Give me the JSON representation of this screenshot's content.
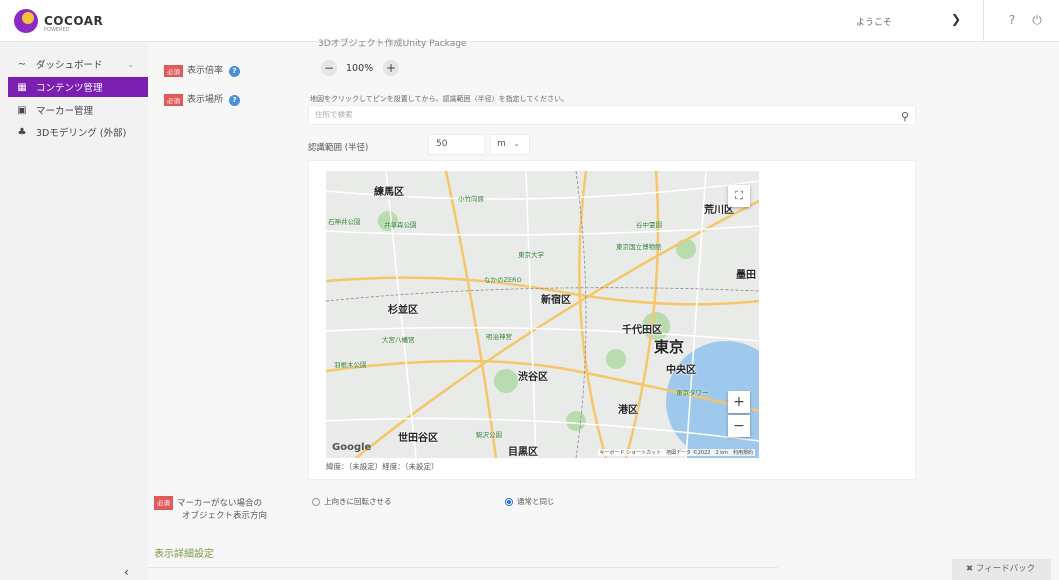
{
  "header": {
    "logo_text": "COCOAR",
    "logo_sub": "POWERED",
    "welcome": "ようこそ",
    "chevron_icon": "chevron-down-icon",
    "help_icon": "help-icon",
    "power_icon": "power-icon"
  },
  "sidebar": {
    "items": [
      {
        "label": "ダッシュボード",
        "icon": "chart-icon"
      },
      {
        "label": "コンテンツ管理",
        "icon": "folder-icon"
      },
      {
        "label": "マーカー管理",
        "icon": "image-icon"
      },
      {
        "label": "3Dモデリング (外部)",
        "icon": "shapes-icon"
      }
    ],
    "collapse_icon": "chevron-left-icon"
  },
  "main": {
    "cutoff_text": "3Dオブジェクト作成Unity Package",
    "required_badge": "必須",
    "scale_label": "表示倍率",
    "scale_value": "100%",
    "minus": "−",
    "plus": "+",
    "location_label": "表示場所",
    "hint": "地図をクリックしてピンを設置してから、認識範囲（半径）を指定してください。",
    "search_placeholder": "住所で検索",
    "radius_label": "認識範囲 (半径)",
    "radius_value": "50",
    "radius_unit": "m",
    "coords": "緯度：（未設定）経度：（未設定）",
    "orientation_label_1": "マーカーがない場合の",
    "orientation_label_2": "オブジェクト表示方向",
    "radio_1": "上向きに回転させる",
    "radio_2": "通常と同じ",
    "section_title": "表示詳細設定",
    "feedback": "フィードバック"
  },
  "map": {
    "labels": [
      "練馬区",
      "荒川区",
      "新宿区",
      "杉並区",
      "千代田区",
      "東京",
      "中央区",
      "渋谷区",
      "港区",
      "世田谷区",
      "目黒区",
      "墨田"
    ],
    "pois": [
      "石神井公園",
      "井草森公園",
      "小竹向原",
      "谷中霊園",
      "東京国立博物館",
      "東京大学",
      "なかのZERO",
      "大宮八幡宮",
      "明治神宮",
      "駒沢公園",
      "東京タワー",
      "羽根木公園"
    ],
    "google": "Google",
    "attribution": "キーボード ショートカット　地図データ ©2022　2 km　利用規約",
    "zoom_in": "+",
    "zoom_out": "−",
    "fullscreen_icon": "fullscreen-icon"
  }
}
